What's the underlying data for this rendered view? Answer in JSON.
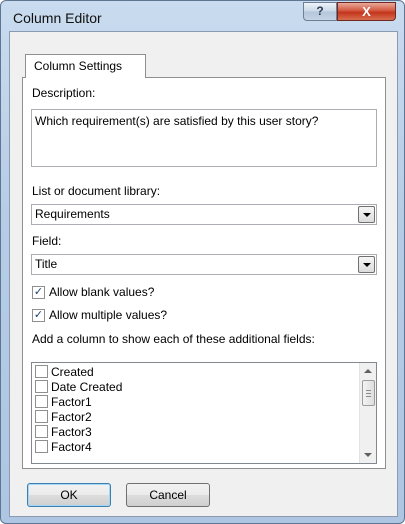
{
  "window": {
    "title": "Column Editor",
    "help_label": "?",
    "close_label": "X"
  },
  "tab": {
    "label": "Column Settings"
  },
  "description": {
    "label": "Description:",
    "value": "Which requirement(s) are satisfied by this user story?"
  },
  "list": {
    "label": "List or document library:",
    "selected": "Requirements"
  },
  "field": {
    "label": "Field:",
    "selected": "Title"
  },
  "options": {
    "allow_blank": {
      "label": "Allow blank values?",
      "checked": true
    },
    "allow_multiple": {
      "label": "Allow multiple values?",
      "checked": true
    }
  },
  "additional": {
    "label": "Add a column to show each of these additional fields:",
    "items": [
      {
        "label": "Created",
        "checked": false
      },
      {
        "label": "Date Created",
        "checked": false
      },
      {
        "label": "Factor1",
        "checked": false
      },
      {
        "label": "Factor2",
        "checked": false
      },
      {
        "label": "Factor3",
        "checked": false
      },
      {
        "label": "Factor4",
        "checked": false
      }
    ]
  },
  "buttons": {
    "ok": "OK",
    "cancel": "Cancel"
  },
  "check_glyph": "✓"
}
